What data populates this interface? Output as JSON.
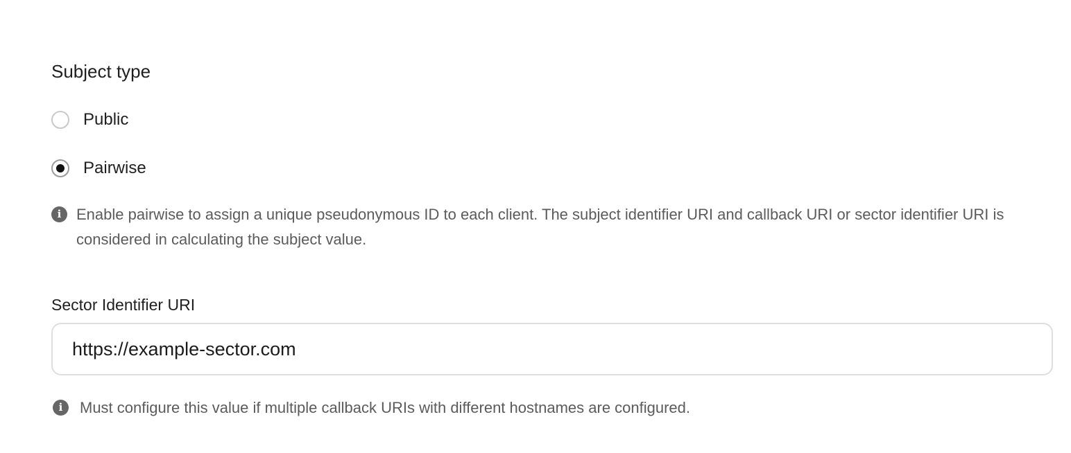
{
  "subject_type": {
    "title": "Subject type",
    "options": [
      {
        "label": "Public",
        "selected": false
      },
      {
        "label": "Pairwise",
        "selected": true
      }
    ],
    "hint": "Enable pairwise to assign a unique pseudonymous ID to each client. The subject identifier URI and callback URI or sector identifier URI is considered in calculating the subject value.",
    "info_icon": "info-circle-icon"
  },
  "sector_identifier": {
    "label": "Sector Identifier URI",
    "value": "https://example-sector.com",
    "hint": "Must configure this value if multiple callback URIs with different hostnames are configured.",
    "info_icon": "info-circle-icon"
  },
  "colors": {
    "text": "#1f1f1f",
    "muted_text": "#5b5b5b",
    "border": "#dedede",
    "radio_dot": "#111111"
  }
}
